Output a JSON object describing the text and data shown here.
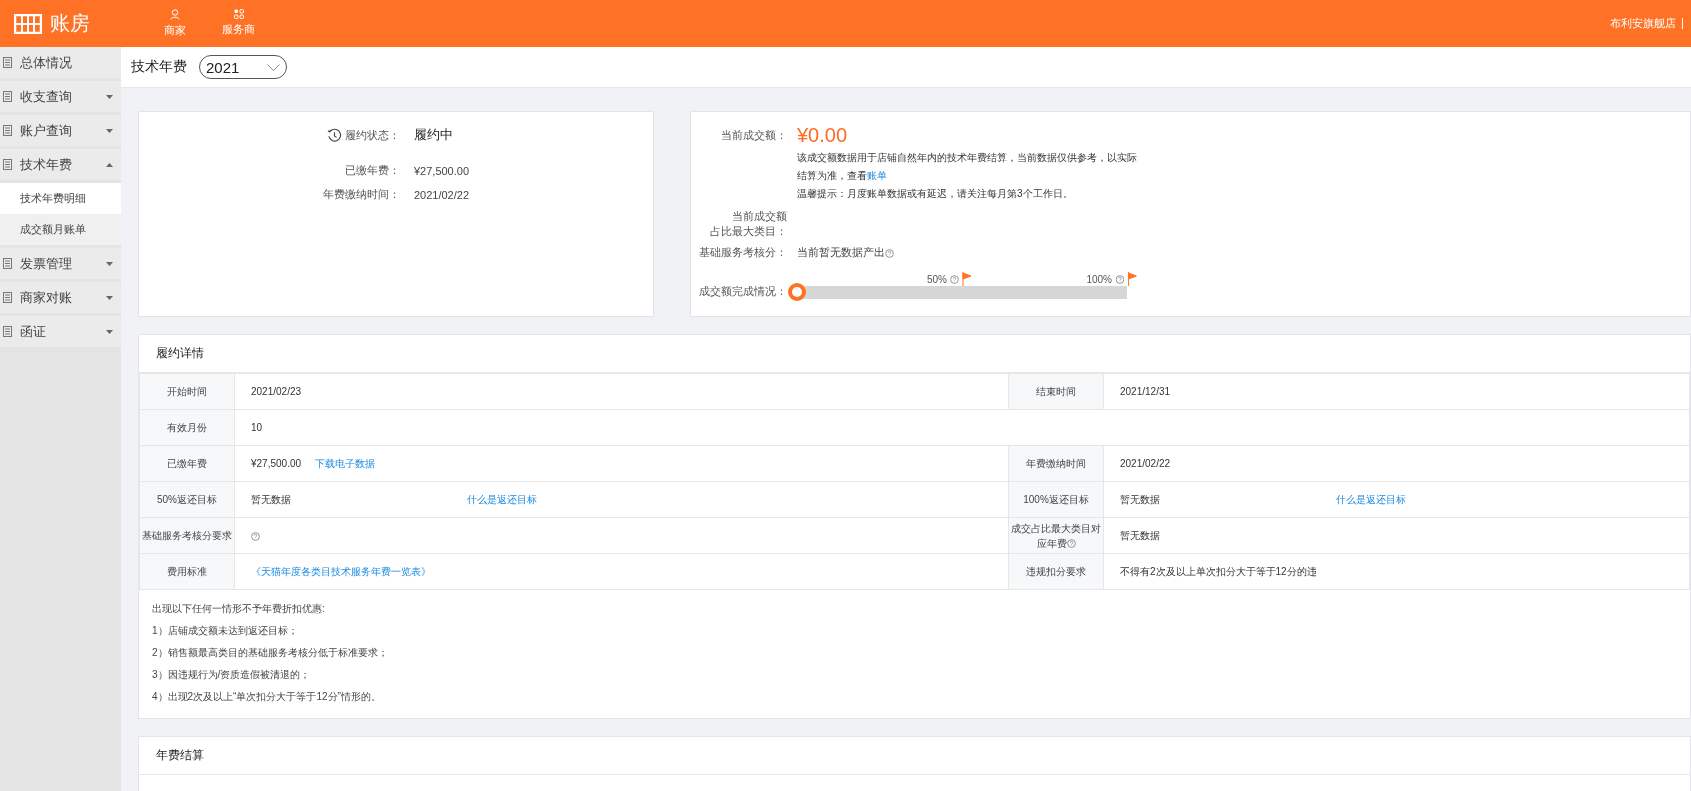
{
  "topbar": {
    "logo": "账房",
    "nav": [
      {
        "label": "商家",
        "kind": "person"
      },
      {
        "label": "服务商",
        "kind": "grid"
      }
    ],
    "store": "布利安旗舰店"
  },
  "sidebar": {
    "items": [
      {
        "label": "总体情况"
      },
      {
        "label": "收支查询",
        "expanded": false
      },
      {
        "label": "账户查询",
        "expanded": false
      },
      {
        "label": "技术年费",
        "expanded": true,
        "children": [
          {
            "label": "技术年费明细",
            "selected": true
          },
          {
            "label": "成交额月账单",
            "selected": false
          }
        ]
      },
      {
        "label": "发票管理",
        "expanded": false
      },
      {
        "label": "商家对账",
        "expanded": false
      },
      {
        "label": "函证",
        "expanded": false
      }
    ]
  },
  "header": {
    "title": "技术年费",
    "year": "2021"
  },
  "summary": {
    "status_label": "履约状态：",
    "status": "履约中",
    "rows": [
      {
        "label": "已缴年费：",
        "value": "¥27,500.00"
      },
      {
        "label": "年费缴纳时间：",
        "value": "2021/02/22"
      }
    ]
  },
  "turnover": {
    "amount_label": "当前成交额：",
    "amount": "¥0.00",
    "note": "该成交额数据用于店铺自然年内的技术年费结算，当前数据仅供参考，以实际结算为准，查看",
    "note_link": "账单",
    "tip": "温馨提示：月度账单数据或有延迟，请关注每月第3个工作日。",
    "category_label": [
      "当前成交额",
      "占比最大类目："
    ],
    "score_label": "基础服务考核分：",
    "score": "当前暂无数据产出",
    "progress_label": "成交额完成情况：",
    "level": 0,
    "markers": [
      "50%",
      "100%"
    ]
  },
  "details": {
    "title": "履约详情",
    "rows": [
      [
        {
          "label": "开始时间",
          "value": "2021/02/23"
        },
        {
          "label": "结束时间",
          "value": "2021/12/31"
        }
      ],
      [
        {
          "label": "有效月份",
          "value": "10"
        }
      ],
      [
        {
          "label": "已缴年费",
          "value": "¥27,500.00",
          "link": "下载电子数据"
        },
        {
          "label": "年费缴纳时间",
          "value": "2021/02/22"
        }
      ],
      [
        {
          "label": "50%返还目标",
          "value": "暂无数据",
          "far_link": "什么是返还目标"
        },
        {
          "label": "100%返还目标",
          "value": "暂无数据",
          "far_link": "什么是返还目标"
        }
      ],
      [
        {
          "label": "基础服务考核分要求",
          "value_help": true
        },
        {
          "label": "成交占比最大类目对应年费",
          "label_help": true,
          "value": "暂无数据"
        }
      ],
      [
        {
          "label": "费用标准",
          "link": "《天猫年度各类目技术服务年费一览表》"
        },
        {
          "label": "违规扣分要求",
          "value": "不得有2次及以上单次扣分大于等于12分的违"
        }
      ]
    ],
    "notes": [
      "出现以下任何一情形不予年费折扣优惠:",
      "1）店铺成交额未达到返还目标；",
      "2）销售额最高类目的基础服务考核分低于标准要求；",
      "3）因违规行为/资质造假被清退的；",
      "4）出现2次及以上“单次扣分大于等于12分”情形的。"
    ]
  },
  "settlement": {
    "title": "年费结算"
  }
}
